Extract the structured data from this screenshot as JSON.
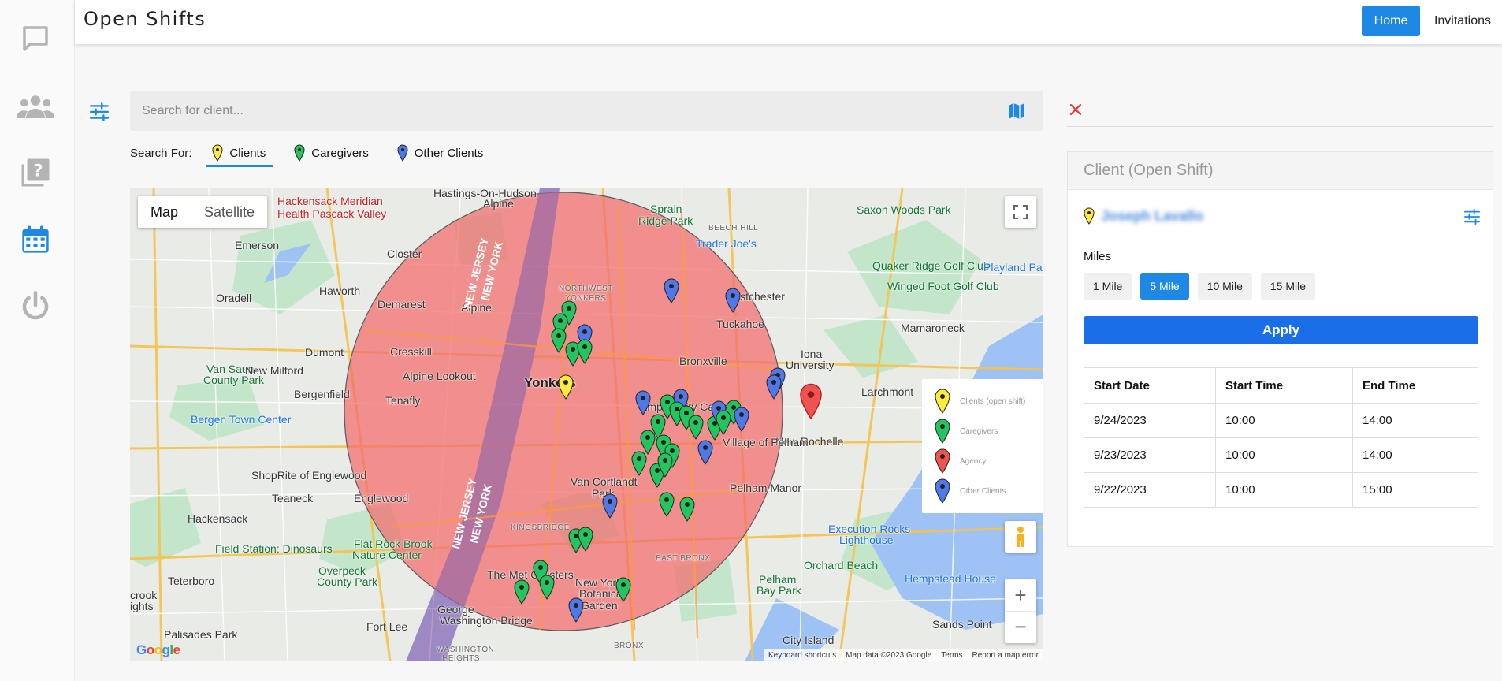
{
  "app": {
    "title": "Open Shifts"
  },
  "rail": {
    "items": [
      {
        "name": "messages-icon"
      },
      {
        "name": "users-icon"
      },
      {
        "name": "help-icon"
      },
      {
        "name": "calendar-icon"
      },
      {
        "name": "power-icon"
      }
    ],
    "active_index": 3,
    "accent_color": "#1e88e5",
    "idle_color": "#b4b4b4"
  },
  "nav": {
    "home": "Home",
    "invitations": "Invitations"
  },
  "search": {
    "placeholder": "Search for client...",
    "label": "Search For:",
    "tabs": [
      {
        "label": "Clients",
        "pin_color": "#ffeb3b",
        "active": true
      },
      {
        "label": "Caregivers",
        "pin_color": "#22c55e",
        "active": false
      },
      {
        "label": "Other Clients",
        "pin_color": "#4f78e8",
        "active": false
      }
    ]
  },
  "map": {
    "types": {
      "map": "Map",
      "satellite": "Satellite"
    },
    "labels": {
      "hastings": "Hastings-On-Hudson",
      "hackensack_hosp_1": "Hackensack Meridian",
      "hackensack_hosp_2": "Health Pascack Valley",
      "alpine": "Alpine",
      "sprain_1": "Sprain",
      "sprain_2": "Ridge Park",
      "saxon_woods": "Saxon Woods Park",
      "emerson": "Emerson",
      "closter": "Closter",
      "trader_joes": "Trader Joe's",
      "beech_hill": "BEECH HILL",
      "quaker": "Quaker Ridge Golf Club",
      "playland": "Playland Pa",
      "winged_foot": "Winged Foot Golf Club",
      "haworth": "Haworth",
      "oradell": "Oradell",
      "demarest": "Demarest",
      "alpine2": "Alpine",
      "nw_yonkers_1": "NORTHWEST",
      "nw_yonkers_2": "YONKERS",
      "eastchester": "Eastchester",
      "tuckahoe": "Tuckahoe",
      "mamaroneck": "Mamaroneck",
      "dumont": "Dumont",
      "cresskill": "Cresskill",
      "bronxville": "Bronxville",
      "iona_1": "Iona",
      "iona_2": "University",
      "van_saun_1": "Van Saun",
      "van_saun_2": "County Park",
      "new_milford": "New Milford",
      "alpine_lookout": "Alpine Lookout",
      "yonkers": "Yonkers",
      "larchmont": "Larchmont",
      "bergenfield": "Bergenfield",
      "tenafly": "Tenafly",
      "empire_city": "Empire City Casino",
      "bergen_town": "Bergen Town Center",
      "new_rochelle": "New Rochelle",
      "village_pelham": "Village of Pelham",
      "shoprite": "ShopRite of Englewood",
      "englewood": "Englewood",
      "van_cortlandt_1": "Van Cortlandt",
      "van_cortlandt_2": "Park",
      "pelham_manor": "Pelham Manor",
      "teaneck": "Teaneck",
      "hackensack": "Hackensack",
      "kingsbridge": "KINGSBRIDGE",
      "execution_rocks_1": "Execution Rocks",
      "execution_rocks_2": "Lighthouse",
      "field_station": "Field Station: Dinosaurs",
      "flat_rock_1": "Flat Rock Brook",
      "flat_rock_2": "Nature Center",
      "east_bronx": "EAST BRONX",
      "orchard_beach": "Orchard Beach",
      "teterboro": "Teterboro",
      "overpeck_1": "Overpeck",
      "overpeck_2": "County Park",
      "met_cloisters": "The Met Cloisters",
      "ny_botanical_1": "New York",
      "ny_botanical_2": "Botanical",
      "ny_botanical_3": "Garden",
      "pelham_bay_1": "Pelham",
      "pelham_bay_2": "Bay Park",
      "hempstead": "Hempstead House",
      "hights": "ights",
      "fort_lee": "Fort Lee",
      "gwb_1": "George",
      "gwb_2": "Washington Bridge",
      "city_island": "City Island",
      "sands_point": "Sands Point",
      "palisades": "Palisades Park",
      "washington_heights_1": "WASHINGTON",
      "washington_heights_2": "HEIGHTS",
      "bronx": "BRONX",
      "nj_1": "NEW JERSEY",
      "ny_1": "NEW YORK",
      "nj_2": "NEW JERSEY",
      "ny_2": "NEW YORK",
      "crook": "crook"
    },
    "legend": [
      {
        "label": "Clients (open shift)",
        "color": "#ffeb3b"
      },
      {
        "label": "Caregivers",
        "color": "#22c55e"
      },
      {
        "label": "Agency",
        "color": "#ef5350"
      },
      {
        "label": "Other Clients",
        "color": "#4f78e8"
      }
    ],
    "footer": {
      "shortcuts": "Keyboard shortcuts",
      "data": "Map data ©2023 Google",
      "terms": "Terms",
      "report": "Report a map error"
    },
    "logo": "Google",
    "radius_fill": "#f26b6b"
  },
  "panel": {
    "title": "Client (Open Shift)",
    "client_name": "Joseph Lavallo",
    "miles_label": "Miles",
    "miles": [
      {
        "label": "1 Mile",
        "active": false
      },
      {
        "label": "5 Mile",
        "active": true
      },
      {
        "label": "10 Mile",
        "active": false
      },
      {
        "label": "15 Mile",
        "active": false
      }
    ],
    "apply": "Apply",
    "table": {
      "headers": [
        "Start Date",
        "Start Time",
        "End Time"
      ],
      "rows": [
        [
          "9/24/2023",
          "10:00",
          "14:00"
        ],
        [
          "9/23/2023",
          "10:00",
          "14:00"
        ],
        [
          "9/22/2023",
          "10:00",
          "15:00"
        ]
      ]
    }
  }
}
